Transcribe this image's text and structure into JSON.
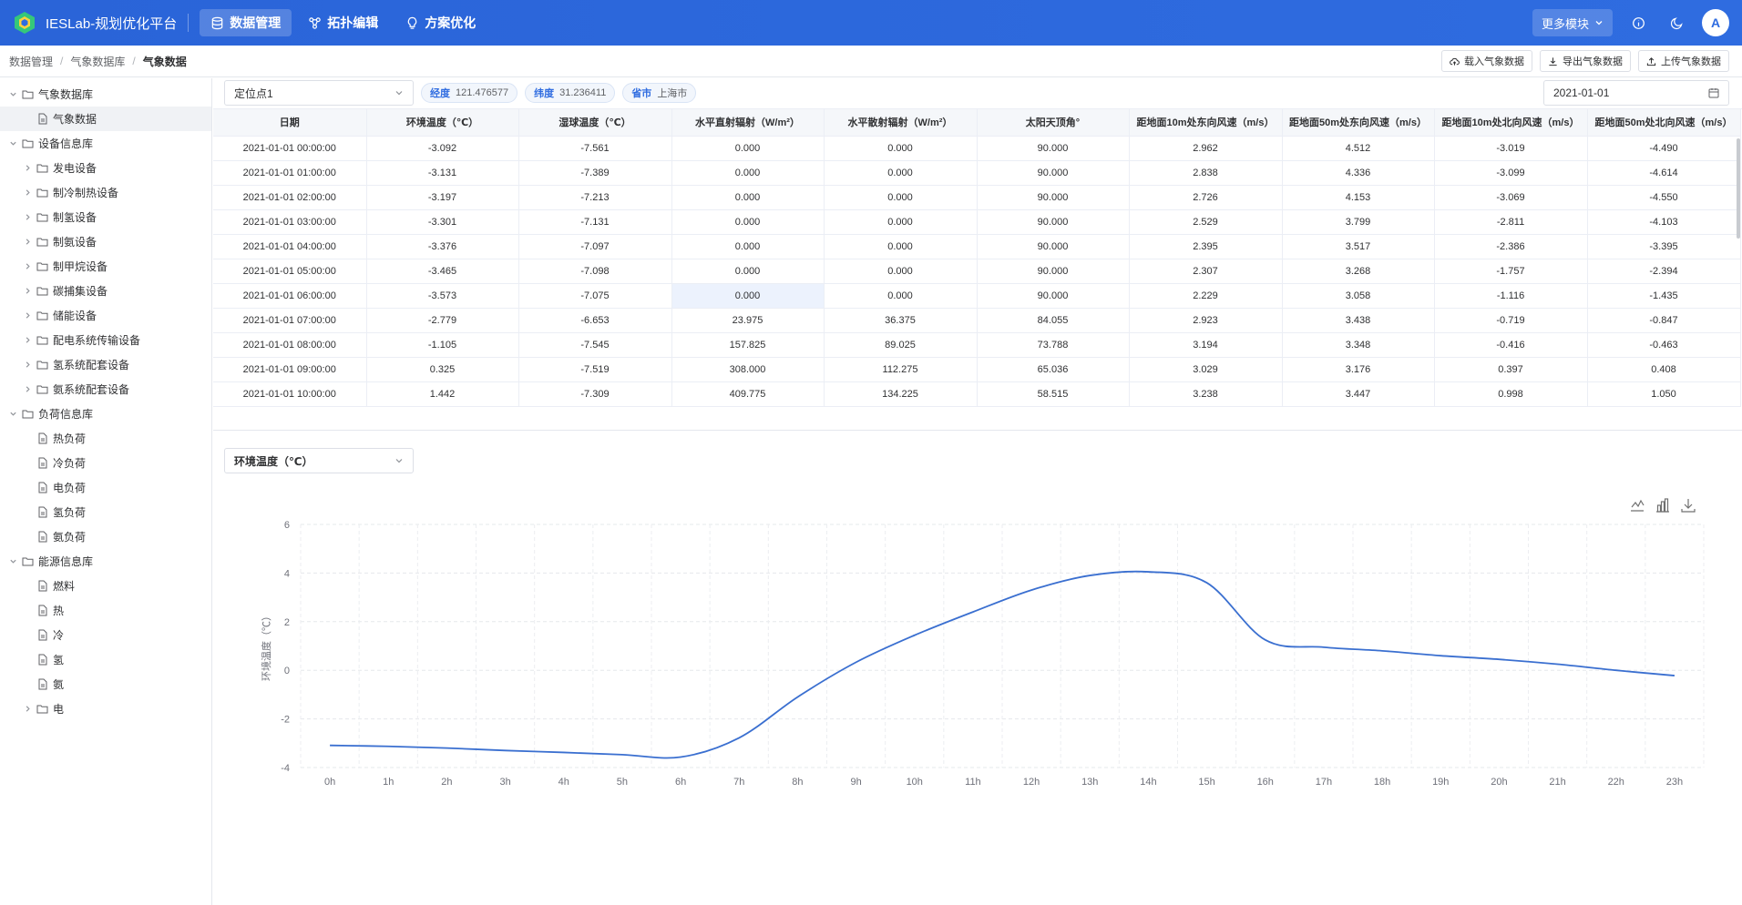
{
  "header": {
    "app_title": "IESLab-规划优化平台",
    "nav": [
      {
        "label": "数据管理",
        "icon": "database-icon",
        "active": true
      },
      {
        "label": "拓扑编辑",
        "icon": "topology-icon",
        "active": false
      },
      {
        "label": "方案优化",
        "icon": "lightbulb-icon",
        "active": false
      }
    ],
    "more_label": "更多模块",
    "avatar_letter": "A",
    "accent": "#2f6ce0"
  },
  "breadcrumb": [
    "数据管理",
    "气象数据库",
    "气象数据"
  ],
  "actions": {
    "load": "载入气象数据",
    "export": "导出气象数据",
    "upload": "上传气象数据"
  },
  "sidebar": [
    {
      "label": "气象数据库",
      "level": 0,
      "type": "folder",
      "expanded": true
    },
    {
      "label": "气象数据",
      "level": 1,
      "type": "file",
      "selected": true
    },
    {
      "label": "设备信息库",
      "level": 0,
      "type": "folder",
      "expanded": true
    },
    {
      "label": "发电设备",
      "level": 1,
      "type": "folder",
      "expanded": false
    },
    {
      "label": "制冷制热设备",
      "level": 1,
      "type": "folder",
      "expanded": false
    },
    {
      "label": "制氢设备",
      "level": 1,
      "type": "folder",
      "expanded": false
    },
    {
      "label": "制氨设备",
      "level": 1,
      "type": "folder",
      "expanded": false
    },
    {
      "label": "制甲烷设备",
      "level": 1,
      "type": "folder",
      "expanded": false
    },
    {
      "label": "碳捕集设备",
      "level": 1,
      "type": "folder",
      "expanded": false
    },
    {
      "label": "储能设备",
      "level": 1,
      "type": "folder",
      "expanded": false
    },
    {
      "label": "配电系统传输设备",
      "level": 1,
      "type": "folder",
      "expanded": false
    },
    {
      "label": "氢系统配套设备",
      "level": 1,
      "type": "folder",
      "expanded": false
    },
    {
      "label": "氨系统配套设备",
      "level": 1,
      "type": "folder",
      "expanded": false
    },
    {
      "label": "负荷信息库",
      "level": 0,
      "type": "folder",
      "expanded": true
    },
    {
      "label": "热负荷",
      "level": 1,
      "type": "file"
    },
    {
      "label": "冷负荷",
      "level": 1,
      "type": "file"
    },
    {
      "label": "电负荷",
      "level": 1,
      "type": "file"
    },
    {
      "label": "氢负荷",
      "level": 1,
      "type": "file"
    },
    {
      "label": "氨负荷",
      "level": 1,
      "type": "file"
    },
    {
      "label": "能源信息库",
      "level": 0,
      "type": "folder",
      "expanded": true
    },
    {
      "label": "燃料",
      "level": 1,
      "type": "file"
    },
    {
      "label": "热",
      "level": 1,
      "type": "file"
    },
    {
      "label": "冷",
      "level": 1,
      "type": "file"
    },
    {
      "label": "氢",
      "level": 1,
      "type": "file"
    },
    {
      "label": "氨",
      "level": 1,
      "type": "file"
    },
    {
      "label": "电",
      "level": 1,
      "type": "folder",
      "expanded": false
    }
  ],
  "filters": {
    "location": "定位点1",
    "lon_label": "经度",
    "lon_value": "121.476577",
    "lat_label": "纬度",
    "lat_value": "31.236411",
    "city_label": "省市",
    "city_value": "上海市",
    "date": "2021-01-01"
  },
  "table": {
    "columns": [
      "日期",
      "环境温度（℃）",
      "湿球温度（℃）",
      "水平直射辐射（W/m²）",
      "水平散射辐射（W/m²）",
      "太阳天顶角°",
      "距地面10m处东向风速（m/s）",
      "距地面50m处东向风速（m/s）",
      "距地面10m处北向风速（m/s）",
      "距地面50m处北向风速（m/s）"
    ],
    "rows": [
      [
        "2021-01-01 00:00:00",
        "-3.092",
        "-7.561",
        "0.000",
        "0.000",
        "90.000",
        "2.962",
        "4.512",
        "-3.019",
        "-4.490"
      ],
      [
        "2021-01-01 01:00:00",
        "-3.131",
        "-7.389",
        "0.000",
        "0.000",
        "90.000",
        "2.838",
        "4.336",
        "-3.099",
        "-4.614"
      ],
      [
        "2021-01-01 02:00:00",
        "-3.197",
        "-7.213",
        "0.000",
        "0.000",
        "90.000",
        "2.726",
        "4.153",
        "-3.069",
        "-4.550"
      ],
      [
        "2021-01-01 03:00:00",
        "-3.301",
        "-7.131",
        "0.000",
        "0.000",
        "90.000",
        "2.529",
        "3.799",
        "-2.811",
        "-4.103"
      ],
      [
        "2021-01-01 04:00:00",
        "-3.376",
        "-7.097",
        "0.000",
        "0.000",
        "90.000",
        "2.395",
        "3.517",
        "-2.386",
        "-3.395"
      ],
      [
        "2021-01-01 05:00:00",
        "-3.465",
        "-7.098",
        "0.000",
        "0.000",
        "90.000",
        "2.307",
        "3.268",
        "-1.757",
        "-2.394"
      ],
      [
        "2021-01-01 06:00:00",
        "-3.573",
        "-7.075",
        "0.000",
        "0.000",
        "90.000",
        "2.229",
        "3.058",
        "-1.116",
        "-1.435"
      ],
      [
        "2021-01-01 07:00:00",
        "-2.779",
        "-6.653",
        "23.975",
        "36.375",
        "84.055",
        "2.923",
        "3.438",
        "-0.719",
        "-0.847"
      ],
      [
        "2021-01-01 08:00:00",
        "-1.105",
        "-7.545",
        "157.825",
        "89.025",
        "73.788",
        "3.194",
        "3.348",
        "-0.416",
        "-0.463"
      ],
      [
        "2021-01-01 09:00:00",
        "0.325",
        "-7.519",
        "308.000",
        "112.275",
        "65.036",
        "3.029",
        "3.176",
        "0.397",
        "0.408"
      ],
      [
        "2021-01-01 10:00:00",
        "1.442",
        "-7.309",
        "409.775",
        "134.225",
        "58.515",
        "3.238",
        "3.447",
        "0.998",
        "1.050"
      ]
    ]
  },
  "chart_select": "环境温度（℃）",
  "chart_data": {
    "type": "line",
    "categories": [
      "0h",
      "1h",
      "2h",
      "3h",
      "4h",
      "5h",
      "6h",
      "7h",
      "8h",
      "9h",
      "10h",
      "11h",
      "12h",
      "13h",
      "14h",
      "15h",
      "16h",
      "17h",
      "18h",
      "19h",
      "20h",
      "21h",
      "22h",
      "23h"
    ],
    "series": [
      {
        "values": [
          -3.09,
          -3.13,
          -3.2,
          -3.3,
          -3.38,
          -3.47,
          -3.57,
          -2.78,
          -1.1,
          0.33,
          1.44,
          2.4,
          3.3,
          3.9,
          4.05,
          3.6,
          1.25,
          0.95,
          0.8,
          0.6,
          0.45,
          0.25,
          0.0,
          -0.22
        ]
      }
    ],
    "ylabel": "环境温度（℃）",
    "yticks": [
      6,
      4,
      2,
      0,
      -2,
      -4
    ],
    "ylim": [
      -4,
      6
    ],
    "grid": true,
    "color": "#3a6fd0"
  }
}
